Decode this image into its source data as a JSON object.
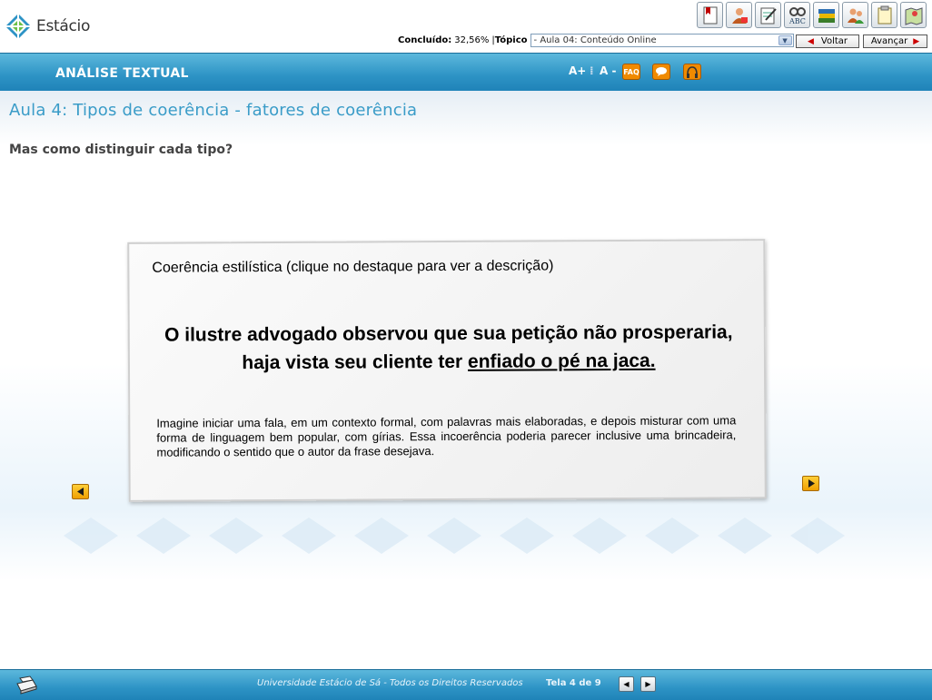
{
  "brand": {
    "name": "Estácio"
  },
  "toolbar": {
    "tools": [
      {
        "name": "bookmark-icon"
      },
      {
        "name": "tutor-icon"
      },
      {
        "name": "notes-icon"
      },
      {
        "name": "dictionary-icon"
      },
      {
        "name": "library-icon"
      },
      {
        "name": "forum-icon"
      },
      {
        "name": "summary-icon"
      },
      {
        "name": "map-icon"
      }
    ]
  },
  "progress": {
    "label": "Concluído:",
    "value": "32,56%",
    "separator": "|",
    "topic_label": "Tópico"
  },
  "topic_select": {
    "selected": "- Aula 04: Conteúdo Online"
  },
  "nav": {
    "back_label": "Voltar",
    "next_label": "Avançar"
  },
  "header": {
    "course_title": "ANÁLISE TEXTUAL",
    "font_increase": "A+",
    "font_decrease": "A -",
    "faq_label": "FAQ"
  },
  "lesson": {
    "title": "Aula 4: Tipos de coerência - fatores de coerência",
    "question": "Mas como distinguir cada tipo?"
  },
  "card": {
    "heading": "Coerência estilística (clique no destaque para ver a descrição)",
    "sentence_part1": "O ilustre advogado observou que sua petição não prosperaria, haja vista seu cliente ter ",
    "sentence_highlight": "enfiado o pé na jaca.",
    "description": "Imagine iniciar uma fala, em um contexto formal, com palavras mais elaboradas, e depois misturar com uma forma de linguagem bem popular, com gírias. Essa incoerência poderia parecer inclusive uma brincadeira, modificando o sentido que o autor da frase desejava."
  },
  "footer": {
    "copyright": "Universidade Estácio de Sá - Todos os Direitos Reservados",
    "screen_counter": "Tela 4 de 9"
  },
  "colors": {
    "accent": "#3a9cc8",
    "header_blue": "#2d93c5",
    "arrow_orange": "#f0a000"
  }
}
